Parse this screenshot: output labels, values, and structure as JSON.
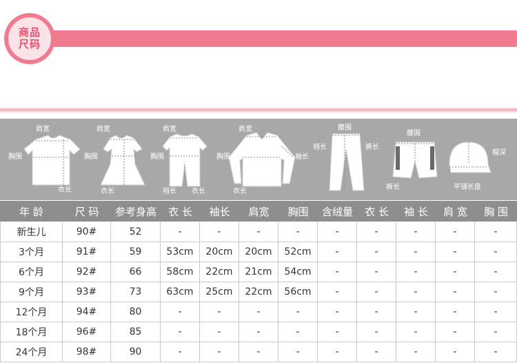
{
  "header": {
    "badge_line1": "商品",
    "badge_line2": "尺码",
    "accent_color": "#f07a90"
  },
  "icons": {
    "tshirt": {
      "shoulder": "肩宽",
      "chest": "胸围",
      "length": "衣长"
    },
    "dress": {
      "shoulder": "肩宽",
      "chest": "胸围",
      "length": "衣长"
    },
    "romper": {
      "shoulder": "肩宽",
      "chest": "胸围",
      "crotch": "裆长",
      "length": "衣长"
    },
    "jacket": {
      "shoulder": "肩宽",
      "chest": "胸围",
      "sleeve": "袖长",
      "length": "衣长"
    },
    "pants": {
      "waist": "腰围",
      "crotch": "裆长",
      "pants_length": "裤长"
    },
    "shorts": {
      "waist": "腰围",
      "pants_length": "裤长"
    },
    "hat": {
      "depth": "帽深",
      "flat_length": "平铺长度"
    }
  },
  "table": {
    "headers": [
      "年 龄",
      "尺 码",
      "参考身高",
      "衣 长",
      "袖长",
      "肩宽",
      "胸围",
      "含绒量",
      "衣 长",
      "袖 长",
      "肩 宽",
      "胸 围"
    ],
    "rows": [
      [
        "新生儿",
        "90#",
        "52",
        "-",
        "-",
        "-",
        "-",
        "-",
        "-",
        "-",
        "-",
        "-"
      ],
      [
        "3个月",
        "91#",
        "59",
        "53cm",
        "20cm",
        "20cm",
        "52cm",
        "-",
        "-",
        "-",
        "-",
        "-"
      ],
      [
        "6个月",
        "92#",
        "66",
        "58cm",
        "22cm",
        "21cm",
        "54cm",
        "-",
        "-",
        "-",
        "-",
        "-"
      ],
      [
        "9个月",
        "93#",
        "73",
        "63cm",
        "25cm",
        "22cm",
        "56cm",
        "-",
        "-",
        "-",
        "-",
        "-"
      ],
      [
        "12个月",
        "94#",
        "80",
        "-",
        "-",
        "-",
        "-",
        "-",
        "-",
        "-",
        "-",
        "-"
      ],
      [
        "18个月",
        "96#",
        "85",
        "-",
        "-",
        "-",
        "-",
        "-",
        "-",
        "-",
        "-",
        "-"
      ],
      [
        "24个月",
        "98#",
        "90",
        "-",
        "-",
        "-",
        "-",
        "-",
        "-",
        "-",
        "-",
        "-"
      ]
    ]
  }
}
